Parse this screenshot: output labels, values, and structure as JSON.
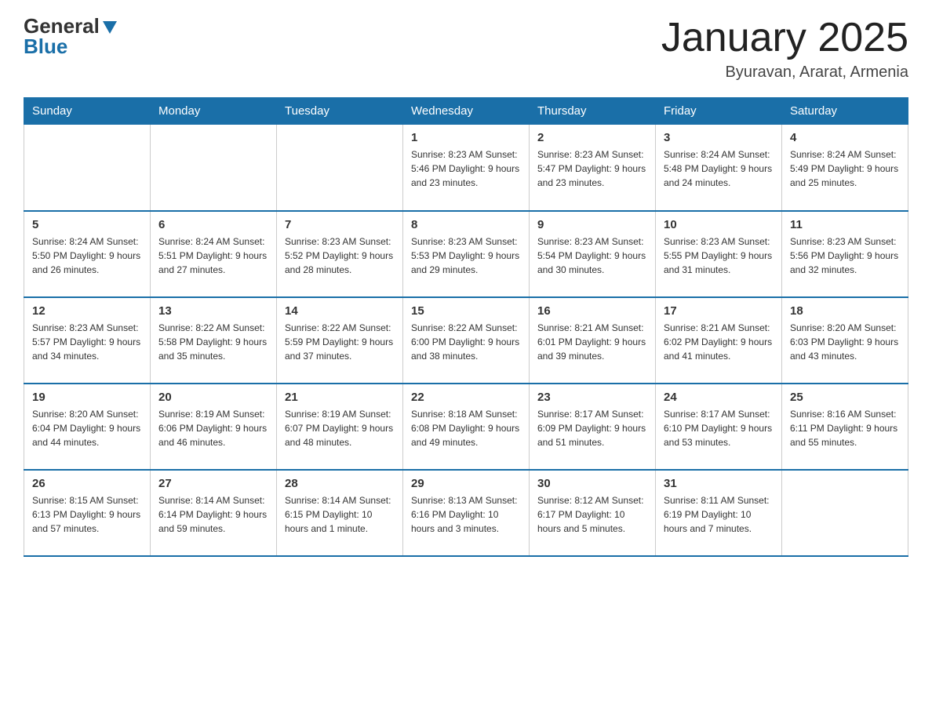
{
  "header": {
    "logo_general": "General",
    "logo_blue": "Blue",
    "title": "January 2025",
    "subtitle": "Byuravan, Ararat, Armenia"
  },
  "days_of_week": [
    "Sunday",
    "Monday",
    "Tuesday",
    "Wednesday",
    "Thursday",
    "Friday",
    "Saturday"
  ],
  "weeks": [
    [
      {
        "day": "",
        "info": ""
      },
      {
        "day": "",
        "info": ""
      },
      {
        "day": "",
        "info": ""
      },
      {
        "day": "1",
        "info": "Sunrise: 8:23 AM\nSunset: 5:46 PM\nDaylight: 9 hours\nand 23 minutes."
      },
      {
        "day": "2",
        "info": "Sunrise: 8:23 AM\nSunset: 5:47 PM\nDaylight: 9 hours\nand 23 minutes."
      },
      {
        "day": "3",
        "info": "Sunrise: 8:24 AM\nSunset: 5:48 PM\nDaylight: 9 hours\nand 24 minutes."
      },
      {
        "day": "4",
        "info": "Sunrise: 8:24 AM\nSunset: 5:49 PM\nDaylight: 9 hours\nand 25 minutes."
      }
    ],
    [
      {
        "day": "5",
        "info": "Sunrise: 8:24 AM\nSunset: 5:50 PM\nDaylight: 9 hours\nand 26 minutes."
      },
      {
        "day": "6",
        "info": "Sunrise: 8:24 AM\nSunset: 5:51 PM\nDaylight: 9 hours\nand 27 minutes."
      },
      {
        "day": "7",
        "info": "Sunrise: 8:23 AM\nSunset: 5:52 PM\nDaylight: 9 hours\nand 28 minutes."
      },
      {
        "day": "8",
        "info": "Sunrise: 8:23 AM\nSunset: 5:53 PM\nDaylight: 9 hours\nand 29 minutes."
      },
      {
        "day": "9",
        "info": "Sunrise: 8:23 AM\nSunset: 5:54 PM\nDaylight: 9 hours\nand 30 minutes."
      },
      {
        "day": "10",
        "info": "Sunrise: 8:23 AM\nSunset: 5:55 PM\nDaylight: 9 hours\nand 31 minutes."
      },
      {
        "day": "11",
        "info": "Sunrise: 8:23 AM\nSunset: 5:56 PM\nDaylight: 9 hours\nand 32 minutes."
      }
    ],
    [
      {
        "day": "12",
        "info": "Sunrise: 8:23 AM\nSunset: 5:57 PM\nDaylight: 9 hours\nand 34 minutes."
      },
      {
        "day": "13",
        "info": "Sunrise: 8:22 AM\nSunset: 5:58 PM\nDaylight: 9 hours\nand 35 minutes."
      },
      {
        "day": "14",
        "info": "Sunrise: 8:22 AM\nSunset: 5:59 PM\nDaylight: 9 hours\nand 37 minutes."
      },
      {
        "day": "15",
        "info": "Sunrise: 8:22 AM\nSunset: 6:00 PM\nDaylight: 9 hours\nand 38 minutes."
      },
      {
        "day": "16",
        "info": "Sunrise: 8:21 AM\nSunset: 6:01 PM\nDaylight: 9 hours\nand 39 minutes."
      },
      {
        "day": "17",
        "info": "Sunrise: 8:21 AM\nSunset: 6:02 PM\nDaylight: 9 hours\nand 41 minutes."
      },
      {
        "day": "18",
        "info": "Sunrise: 8:20 AM\nSunset: 6:03 PM\nDaylight: 9 hours\nand 43 minutes."
      }
    ],
    [
      {
        "day": "19",
        "info": "Sunrise: 8:20 AM\nSunset: 6:04 PM\nDaylight: 9 hours\nand 44 minutes."
      },
      {
        "day": "20",
        "info": "Sunrise: 8:19 AM\nSunset: 6:06 PM\nDaylight: 9 hours\nand 46 minutes."
      },
      {
        "day": "21",
        "info": "Sunrise: 8:19 AM\nSunset: 6:07 PM\nDaylight: 9 hours\nand 48 minutes."
      },
      {
        "day": "22",
        "info": "Sunrise: 8:18 AM\nSunset: 6:08 PM\nDaylight: 9 hours\nand 49 minutes."
      },
      {
        "day": "23",
        "info": "Sunrise: 8:17 AM\nSunset: 6:09 PM\nDaylight: 9 hours\nand 51 minutes."
      },
      {
        "day": "24",
        "info": "Sunrise: 8:17 AM\nSunset: 6:10 PM\nDaylight: 9 hours\nand 53 minutes."
      },
      {
        "day": "25",
        "info": "Sunrise: 8:16 AM\nSunset: 6:11 PM\nDaylight: 9 hours\nand 55 minutes."
      }
    ],
    [
      {
        "day": "26",
        "info": "Sunrise: 8:15 AM\nSunset: 6:13 PM\nDaylight: 9 hours\nand 57 minutes."
      },
      {
        "day": "27",
        "info": "Sunrise: 8:14 AM\nSunset: 6:14 PM\nDaylight: 9 hours\nand 59 minutes."
      },
      {
        "day": "28",
        "info": "Sunrise: 8:14 AM\nSunset: 6:15 PM\nDaylight: 10 hours\nand 1 minute."
      },
      {
        "day": "29",
        "info": "Sunrise: 8:13 AM\nSunset: 6:16 PM\nDaylight: 10 hours\nand 3 minutes."
      },
      {
        "day": "30",
        "info": "Sunrise: 8:12 AM\nSunset: 6:17 PM\nDaylight: 10 hours\nand 5 minutes."
      },
      {
        "day": "31",
        "info": "Sunrise: 8:11 AM\nSunset: 6:19 PM\nDaylight: 10 hours\nand 7 minutes."
      },
      {
        "day": "",
        "info": ""
      }
    ]
  ]
}
